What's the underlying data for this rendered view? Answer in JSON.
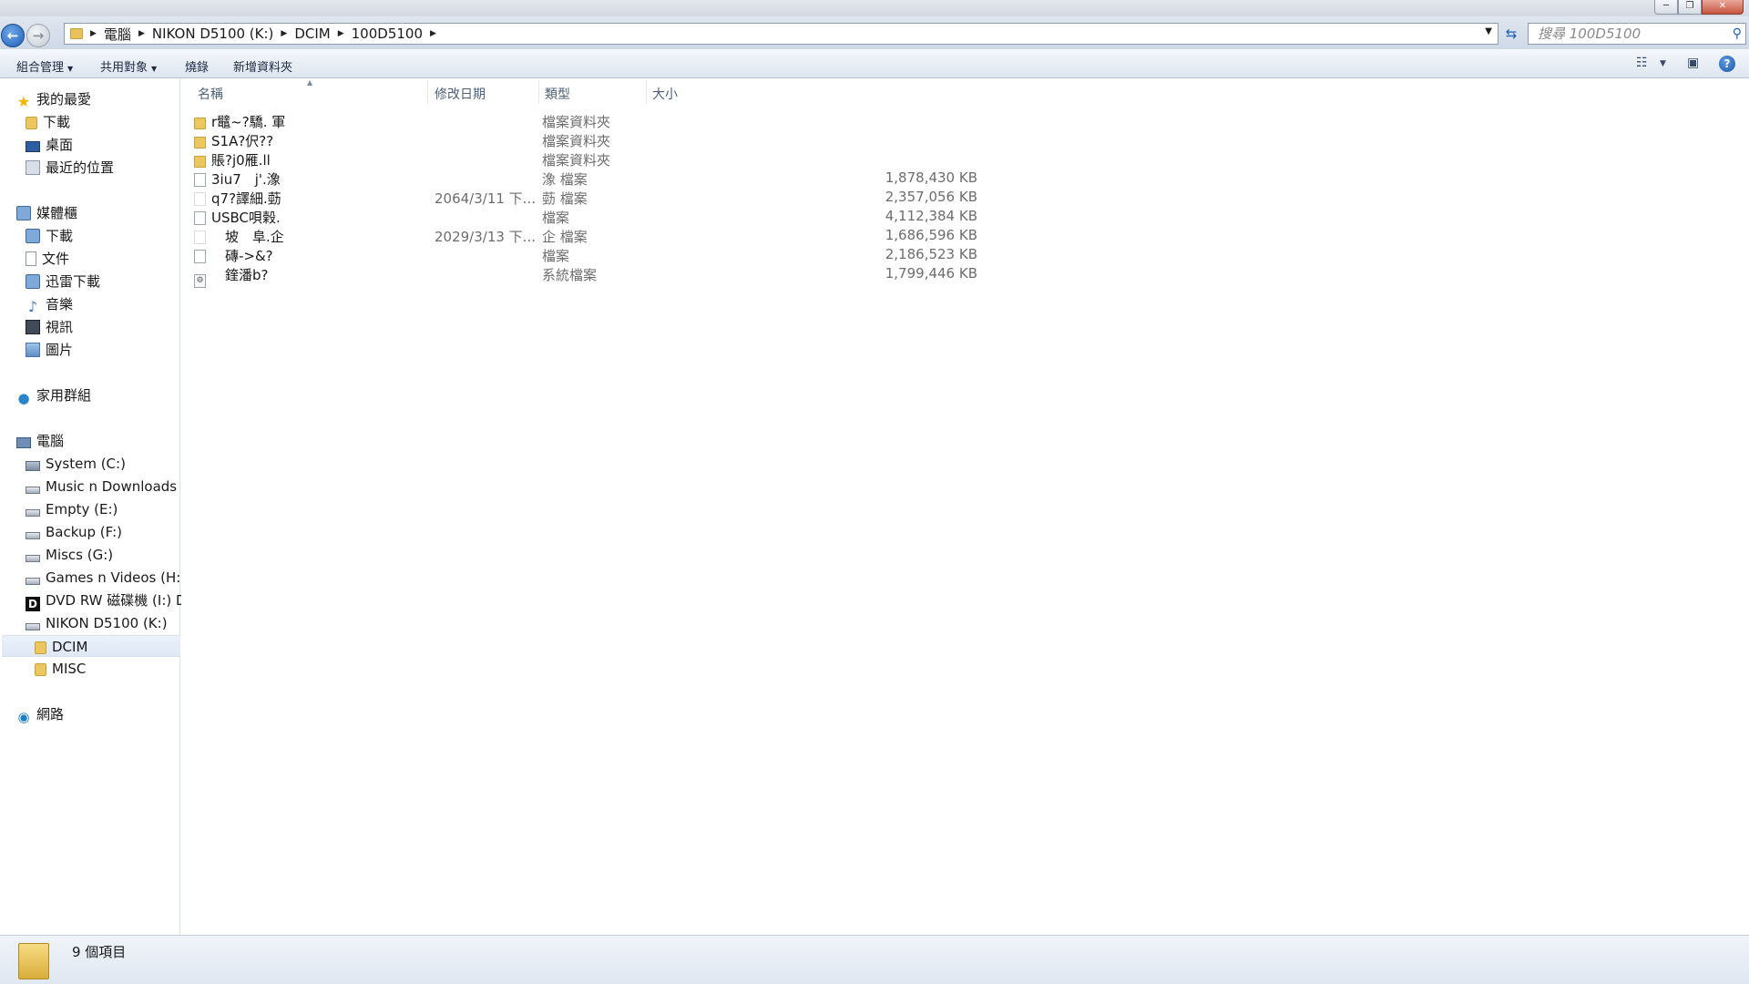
{
  "window": {
    "title": "",
    "buttons": {
      "minimize": "─",
      "maximize": "❐",
      "close": "✕"
    }
  },
  "nav": {
    "back_icon": "←",
    "forward_icon": "→"
  },
  "breadcrumb": {
    "segments": [
      "電腦",
      "NIKON D5100 (K:)",
      "DCIM",
      "100D5100"
    ],
    "separator": "▶"
  },
  "search": {
    "placeholder": "搜尋 100D5100"
  },
  "toolbar": {
    "organize": "組合管理",
    "share": "共用對象",
    "burn": "燒錄",
    "new_folder": "新增資料夾"
  },
  "sidebar": {
    "favorites": {
      "header": "我的最愛",
      "items": [
        "下載",
        "桌面",
        "最近的位置"
      ]
    },
    "libraries": {
      "header": "媒體櫃",
      "items": [
        "下載",
        "文件",
        "迅雷下載",
        "音樂",
        "視訊",
        "圖片"
      ]
    },
    "homegroup": "家用群組",
    "computer": {
      "header": "電腦",
      "drives": [
        "System (C:)",
        "Music n Downloads (",
        "Empty (E:)",
        "Backup (F:)",
        "Miscs (G:)",
        "Games n Videos (H:)",
        "DVD RW 磁碟機 (I:) D",
        "NIKON D5100 (K:)"
      ],
      "subfolders": [
        "DCIM",
        "MISC"
      ]
    },
    "network": "網路"
  },
  "columns": {
    "name": "名稱",
    "date": "修改日期",
    "type": "類型",
    "size": "大小"
  },
  "files": [
    {
      "icon": "folder",
      "name": "r鼊~?驕. 軍",
      "date": "",
      "type": "檔案資料夾",
      "size": ""
    },
    {
      "icon": "folder",
      "name": "S1A?伬??",
      "date": "",
      "type": "檔案資料夾",
      "size": ""
    },
    {
      "icon": "folder",
      "name": "賬?j0雁.ll",
      "date": "",
      "type": "檔案資料夾",
      "size": ""
    },
    {
      "icon": "file",
      "name": "3iu7　j'.潒",
      "date": "",
      "type": "潒 檔案",
      "size": "1,878,430 KB"
    },
    {
      "icon": "blank",
      "name": "q7?譯細.葝",
      "date": "2064/3/11 下...",
      "type": "葝 檔案",
      "size": "2,357,056 KB"
    },
    {
      "icon": "file",
      "name": "USBC唄榖.",
      "date": "",
      "type": "檔案",
      "size": "4,112,384 KB"
    },
    {
      "icon": "blank",
      "name": "　坡　阜.企",
      "date": "2029/3/13 下...",
      "type": "企 檔案",
      "size": "1,686,596 KB"
    },
    {
      "icon": "file",
      "name": "　磚->&?",
      "date": "",
      "type": "檔案",
      "size": "2,186,523 KB"
    },
    {
      "icon": "sys",
      "name": "　鍷潘b?",
      "date": "",
      "type": "系統檔案",
      "size": "1,799,446 KB"
    }
  ],
  "status": {
    "item_count": "9 個項目"
  }
}
